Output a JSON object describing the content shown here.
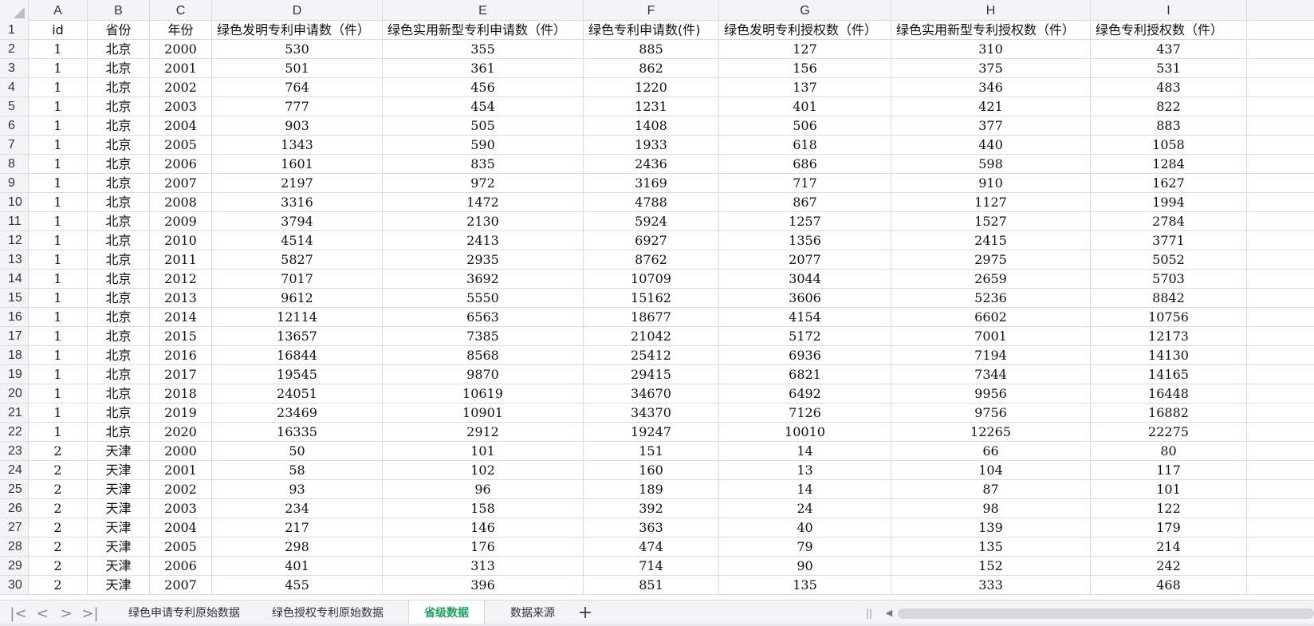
{
  "columns": [
    "A",
    "B",
    "C",
    "D",
    "E",
    "F",
    "G",
    "H",
    "I"
  ],
  "header_row": {
    "row_number": "1",
    "cells": [
      "id",
      "省份",
      "年份",
      "绿色发明专利申请数（件）",
      "绿色实用新型专利申请数（件）",
      "绿色专利申请数(件)",
      "绿色发明专利授权数（件）",
      "绿色实用新型专利授权数（件）",
      "绿色专利授权数（件）"
    ]
  },
  "rows": [
    {
      "n": "2",
      "cells": [
        "1",
        "北京",
        "2000",
        "530",
        "355",
        "885",
        "127",
        "310",
        "437"
      ]
    },
    {
      "n": "3",
      "cells": [
        "1",
        "北京",
        "2001",
        "501",
        "361",
        "862",
        "156",
        "375",
        "531"
      ]
    },
    {
      "n": "4",
      "cells": [
        "1",
        "北京",
        "2002",
        "764",
        "456",
        "1220",
        "137",
        "346",
        "483"
      ]
    },
    {
      "n": "5",
      "cells": [
        "1",
        "北京",
        "2003",
        "777",
        "454",
        "1231",
        "401",
        "421",
        "822"
      ]
    },
    {
      "n": "6",
      "cells": [
        "1",
        "北京",
        "2004",
        "903",
        "505",
        "1408",
        "506",
        "377",
        "883"
      ]
    },
    {
      "n": "7",
      "cells": [
        "1",
        "北京",
        "2005",
        "1343",
        "590",
        "1933",
        "618",
        "440",
        "1058"
      ]
    },
    {
      "n": "8",
      "cells": [
        "1",
        "北京",
        "2006",
        "1601",
        "835",
        "2436",
        "686",
        "598",
        "1284"
      ]
    },
    {
      "n": "9",
      "cells": [
        "1",
        "北京",
        "2007",
        "2197",
        "972",
        "3169",
        "717",
        "910",
        "1627"
      ]
    },
    {
      "n": "10",
      "cells": [
        "1",
        "北京",
        "2008",
        "3316",
        "1472",
        "4788",
        "867",
        "1127",
        "1994"
      ]
    },
    {
      "n": "11",
      "cells": [
        "1",
        "北京",
        "2009",
        "3794",
        "2130",
        "5924",
        "1257",
        "1527",
        "2784"
      ]
    },
    {
      "n": "12",
      "cells": [
        "1",
        "北京",
        "2010",
        "4514",
        "2413",
        "6927",
        "1356",
        "2415",
        "3771"
      ]
    },
    {
      "n": "13",
      "cells": [
        "1",
        "北京",
        "2011",
        "5827",
        "2935",
        "8762",
        "2077",
        "2975",
        "5052"
      ]
    },
    {
      "n": "14",
      "cells": [
        "1",
        "北京",
        "2012",
        "7017",
        "3692",
        "10709",
        "3044",
        "2659",
        "5703"
      ]
    },
    {
      "n": "15",
      "cells": [
        "1",
        "北京",
        "2013",
        "9612",
        "5550",
        "15162",
        "3606",
        "5236",
        "8842"
      ]
    },
    {
      "n": "16",
      "cells": [
        "1",
        "北京",
        "2014",
        "12114",
        "6563",
        "18677",
        "4154",
        "6602",
        "10756"
      ]
    },
    {
      "n": "17",
      "cells": [
        "1",
        "北京",
        "2015",
        "13657",
        "7385",
        "21042",
        "5172",
        "7001",
        "12173"
      ]
    },
    {
      "n": "18",
      "cells": [
        "1",
        "北京",
        "2016",
        "16844",
        "8568",
        "25412",
        "6936",
        "7194",
        "14130"
      ]
    },
    {
      "n": "19",
      "cells": [
        "1",
        "北京",
        "2017",
        "19545",
        "9870",
        "29415",
        "6821",
        "7344",
        "14165"
      ]
    },
    {
      "n": "20",
      "cells": [
        "1",
        "北京",
        "2018",
        "24051",
        "10619",
        "34670",
        "6492",
        "9956",
        "16448"
      ]
    },
    {
      "n": "21",
      "cells": [
        "1",
        "北京",
        "2019",
        "23469",
        "10901",
        "34370",
        "7126",
        "9756",
        "16882"
      ]
    },
    {
      "n": "22",
      "cells": [
        "1",
        "北京",
        "2020",
        "16335",
        "2912",
        "19247",
        "10010",
        "12265",
        "22275"
      ]
    },
    {
      "n": "23",
      "cells": [
        "2",
        "天津",
        "2000",
        "50",
        "101",
        "151",
        "14",
        "66",
        "80"
      ]
    },
    {
      "n": "24",
      "cells": [
        "2",
        "天津",
        "2001",
        "58",
        "102",
        "160",
        "13",
        "104",
        "117"
      ]
    },
    {
      "n": "25",
      "cells": [
        "2",
        "天津",
        "2002",
        "93",
        "96",
        "189",
        "14",
        "87",
        "101"
      ]
    },
    {
      "n": "26",
      "cells": [
        "2",
        "天津",
        "2003",
        "234",
        "158",
        "392",
        "24",
        "98",
        "122"
      ]
    },
    {
      "n": "27",
      "cells": [
        "2",
        "天津",
        "2004",
        "217",
        "146",
        "363",
        "40",
        "139",
        "179"
      ]
    },
    {
      "n": "28",
      "cells": [
        "2",
        "天津",
        "2005",
        "298",
        "176",
        "474",
        "79",
        "135",
        "214"
      ]
    },
    {
      "n": "29",
      "cells": [
        "2",
        "天津",
        "2006",
        "401",
        "313",
        "714",
        "90",
        "152",
        "242"
      ]
    },
    {
      "n": "30",
      "cells": [
        "2",
        "天津",
        "2007",
        "455",
        "396",
        "851",
        "135",
        "333",
        "468"
      ]
    }
  ],
  "sheet_tabs": {
    "nav_first_icon": "first-sheet-icon",
    "nav_prev_icon": "previous-sheet-icon",
    "nav_next_icon": "next-sheet-icon",
    "nav_last_icon": "last-sheet-icon",
    "tabs": [
      {
        "label": "绿色申请专利原始数据",
        "active": false
      },
      {
        "label": "绿色授权专利原始数据",
        "active": false
      },
      {
        "label": "省级数据",
        "active": true
      },
      {
        "label": "数据来源",
        "active": false
      }
    ],
    "add_icon": "plus-icon"
  },
  "colors": {
    "active_tab": "#1aa260",
    "grid_line": "#d9d9ec",
    "header_bg": "#f4f4f6"
  }
}
